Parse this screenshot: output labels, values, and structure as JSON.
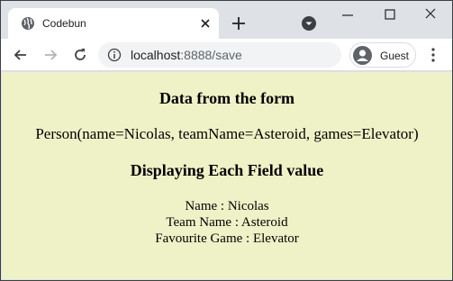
{
  "browser": {
    "tab": {
      "title": "Codebun",
      "favicon": "globe-icon"
    },
    "address_bar": {
      "host": "localhost",
      "path": ":8888/save"
    },
    "profile": {
      "label": "Guest"
    },
    "icons": [
      "globe-icon",
      "close-icon",
      "plus-icon",
      "dropdown-icon",
      "minimize-icon",
      "maximize-icon",
      "close-window-icon",
      "back-arrow-icon",
      "forward-arrow-icon",
      "reload-icon",
      "info-icon",
      "avatar-icon",
      "kebab-menu-icon"
    ]
  },
  "page": {
    "background": "#eff2c7",
    "heading1": "Data from the form",
    "person_line": "Person(name=Nicolas, teamName=Asteroid, games=Elevator)",
    "heading2": "Displaying Each Field value",
    "fields": [
      "Name : Nicolas",
      "Team Name : Asteroid",
      "Favourite Game : Elevator"
    ]
  }
}
